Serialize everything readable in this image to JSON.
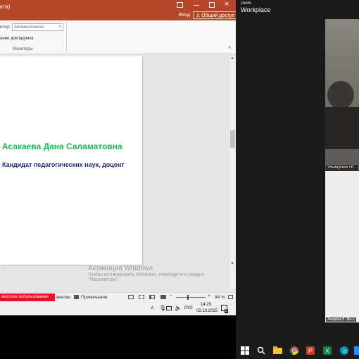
{
  "ppt": {
    "title_fragment": "кта)",
    "sign_in": "Вход",
    "share": "Общий доступ",
    "ribbon_label_monitor": "итор:",
    "ribbon_value_monitor": "Автоматически",
    "ribbon_checkbox": "ание докладчика",
    "ribbon_group": "Мониторы",
    "slide": {
      "name": "Асакаева Дана Саламатовна",
      "role": "Кандидат педагогических наук, доцент"
    },
    "status": {
      "coauthor": "местное использование",
      "notes": "аметки",
      "comments": "Примечания",
      "zoom": "84 %"
    },
    "clock": {
      "time": "14:29",
      "date": "02.10.2025",
      "lang": "РУС",
      "badge": "5"
    }
  },
  "watermark": {
    "line1": "Активация Windows",
    "line2": "Чтобы активировать Windows, перейдите в раздел",
    "line3": "\"Параметры\"."
  },
  "zoom": {
    "brand_small": "zoom",
    "brand": "Workplace",
    "participant1": "Ульпаускал сб...",
    "participant2": "Академ.Л. Ва-с"
  },
  "colors": {
    "ppt_accent": "#b7472a",
    "name_green": "#1db954",
    "role_navy": "#1f2f6b",
    "coauthor_red": "#e81123"
  }
}
